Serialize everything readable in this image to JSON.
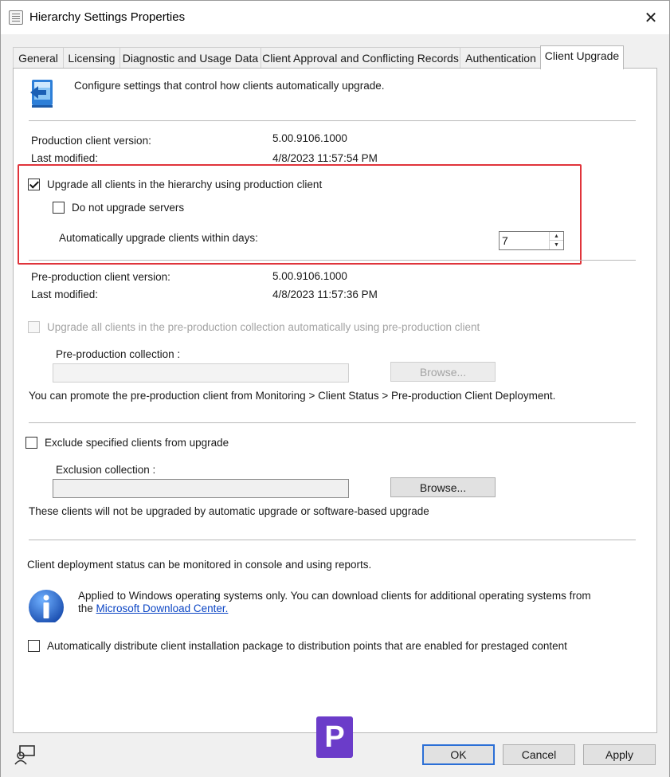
{
  "window": {
    "title": "Hierarchy Settings Properties",
    "close_glyph": "✕"
  },
  "tabs": [
    {
      "label": "General"
    },
    {
      "label": "Licensing"
    },
    {
      "label": "Diagnostic and Usage Data"
    },
    {
      "label": "Client Approval and Conflicting Records"
    },
    {
      "label": "Authentication"
    },
    {
      "label": "Client Upgrade",
      "active": true
    }
  ],
  "header": {
    "description": "Configure settings that control how clients automatically upgrade."
  },
  "production": {
    "version_label": "Production client version:",
    "version_value": "5.00.9106.1000",
    "modified_label": "Last modified:",
    "modified_value": "4/8/2023 11:57:54 PM",
    "upgrade_all_label": "Upgrade all clients in the hierarchy using production client",
    "upgrade_all_checked": true,
    "no_servers_label": "Do not upgrade servers",
    "no_servers_checked": false,
    "days_label": "Automatically upgrade clients within days:",
    "days_value": "7"
  },
  "preproduction": {
    "version_label": "Pre-production client version:",
    "version_value": "5.00.9106.1000",
    "modified_label": "Last modified:",
    "modified_value": "4/8/2023 11:57:36 PM",
    "upgrade_label": "Upgrade all clients in the pre-production collection automatically using pre-production client",
    "collection_label": "Pre-production collection :",
    "browse_label": "Browse...",
    "promote_text": "You can promote the pre-production client from Monitoring > Client Status > Pre-production Client Deployment."
  },
  "exclusion": {
    "exclude_label": "Exclude specified clients from upgrade",
    "collection_label": "Exclusion collection :",
    "browse_label": "Browse...",
    "note": "These clients will not be upgraded by automatic upgrade or software-based upgrade"
  },
  "deployment": {
    "status_text": "Client deployment status can be monitored in console and using reports.",
    "info_line1": "Applied to Windows operating systems only. You can download clients for additional operating systems from",
    "info_line2_prefix": "the",
    "info_link": "Microsoft Download Center.",
    "distribute_label": "Automatically distribute client installation package to distribution points that are enabled for prestaged content"
  },
  "footer": {
    "ok_label": "OK",
    "cancel_label": "Cancel",
    "apply_label": "Apply",
    "watermark_letter": "P"
  },
  "colors": {
    "highlight_box": "#e0343b",
    "link": "#0b45c4",
    "ok_border": "#2b6fd6",
    "watermark": "#6b3cc9"
  }
}
